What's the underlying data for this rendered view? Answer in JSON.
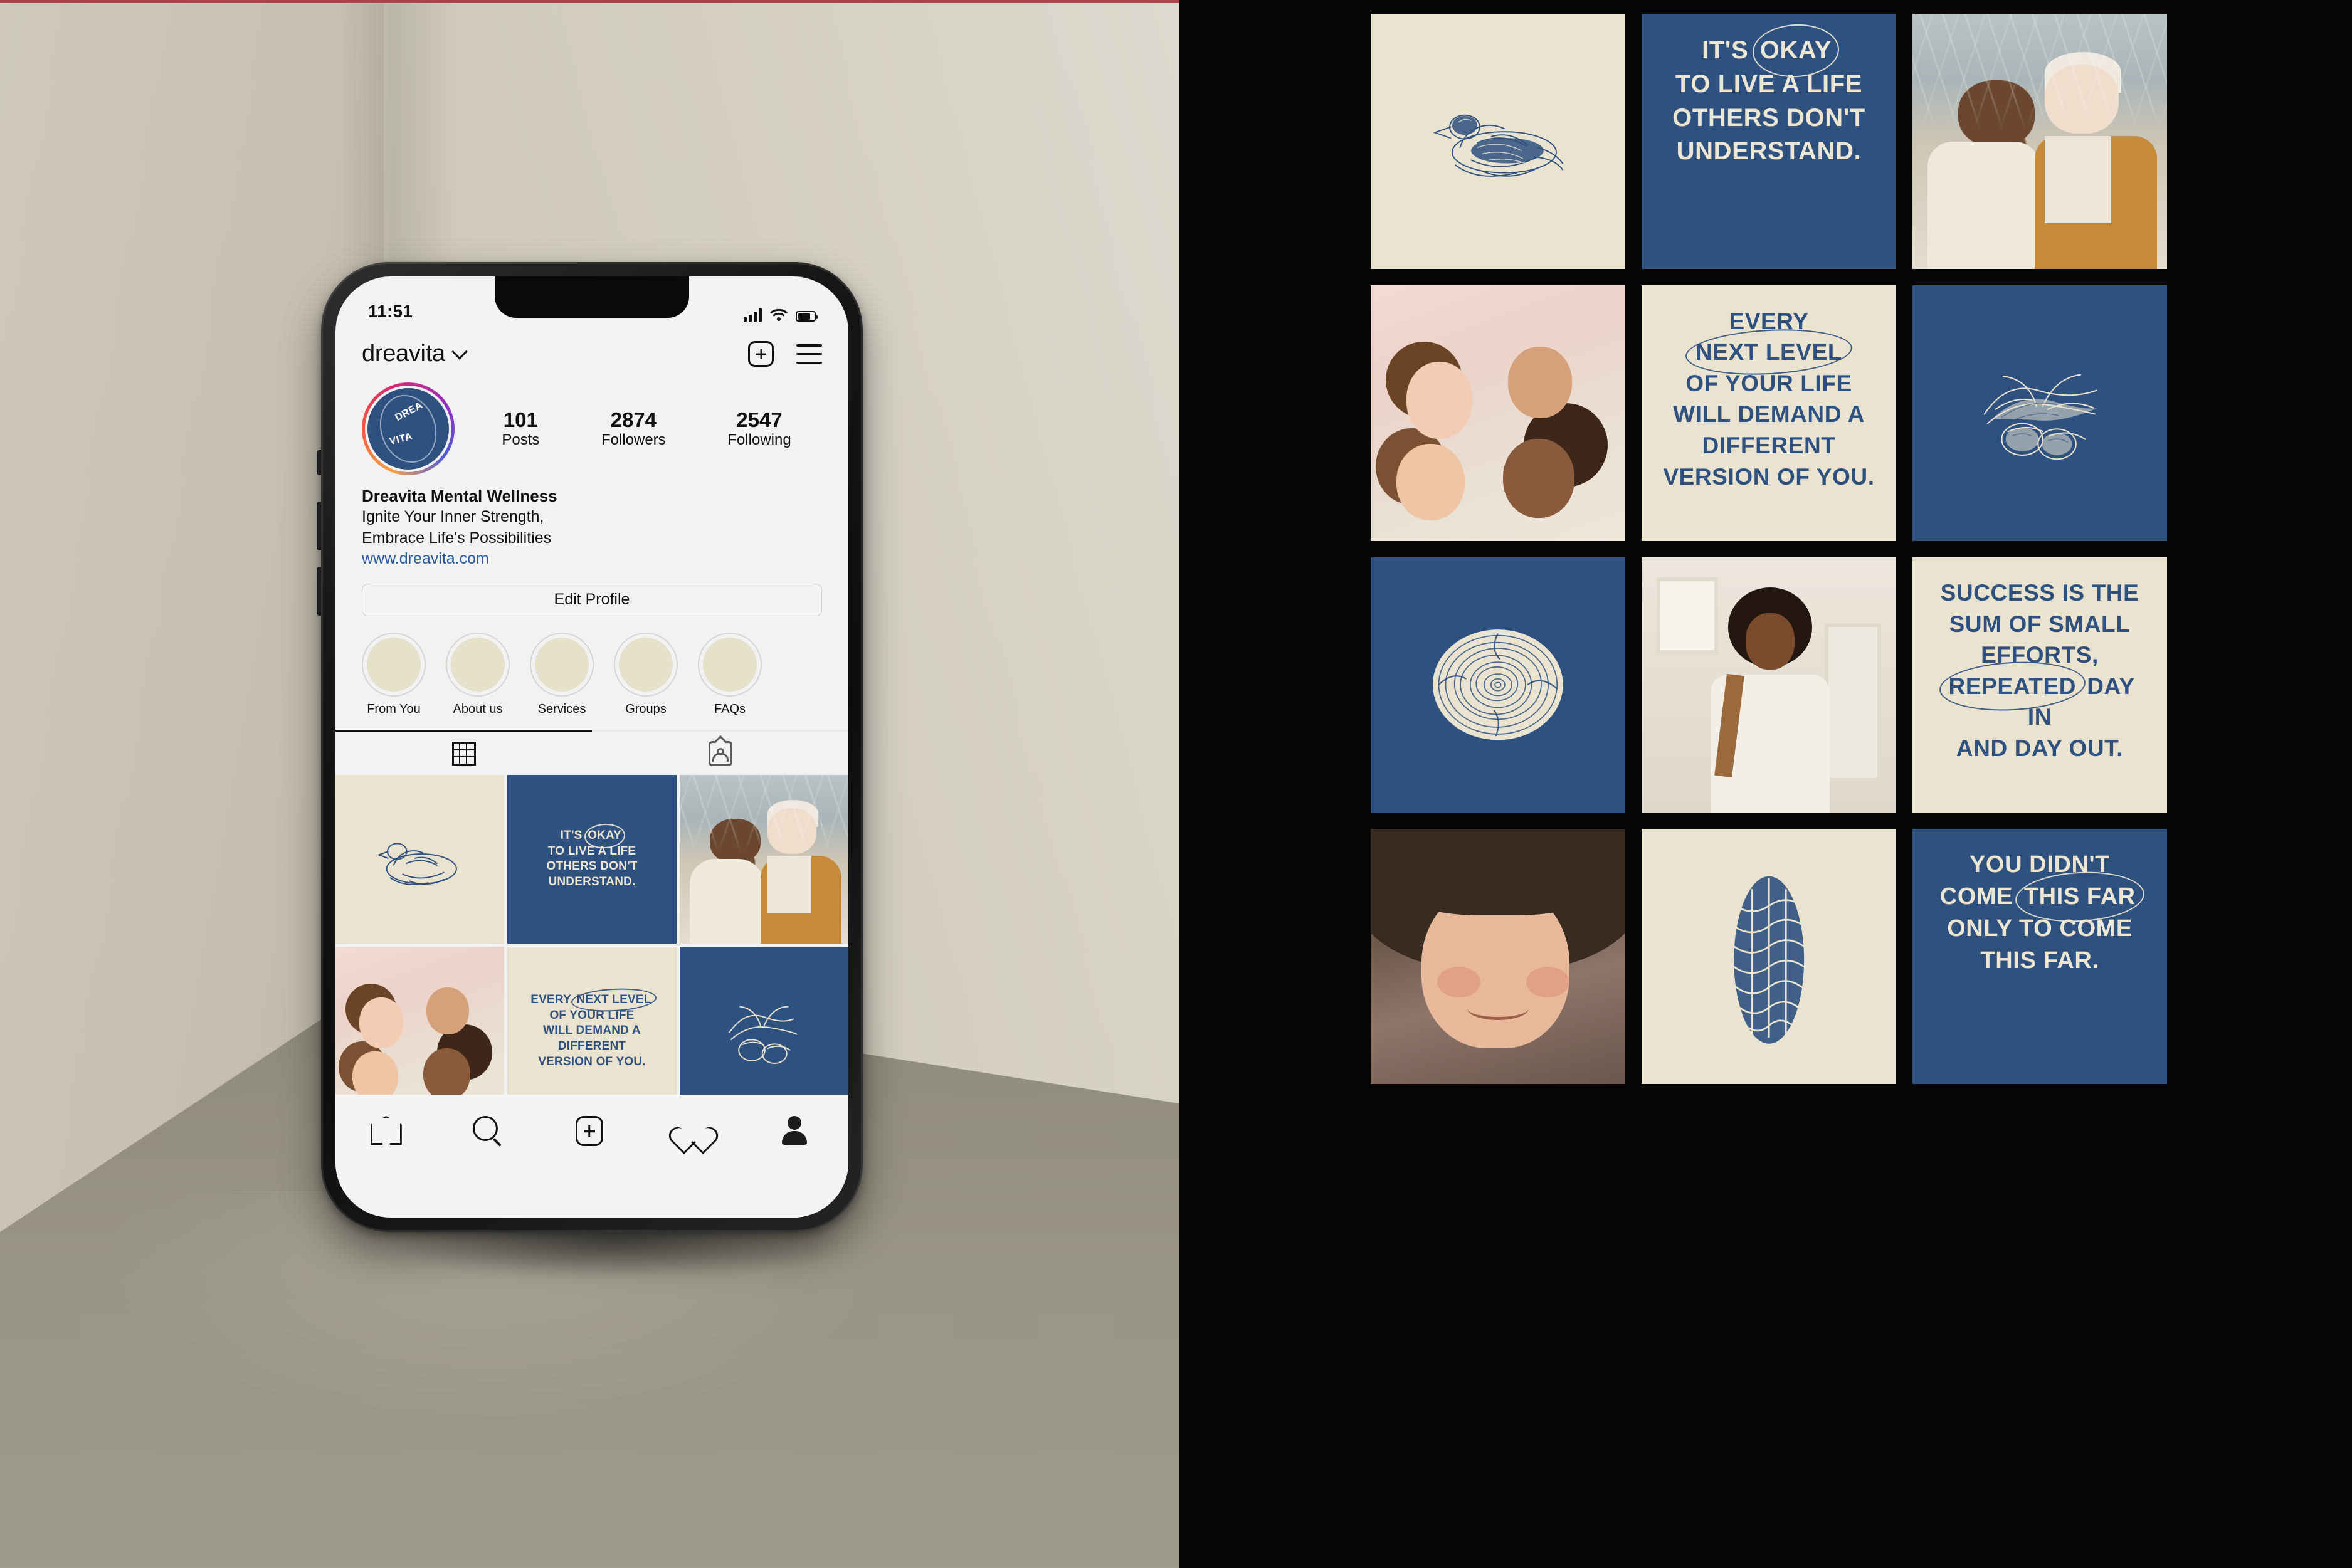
{
  "left_panel": {
    "scene": "phone-mockup-on-desk",
    "phone": {
      "status_bar": {
        "time": "11:51",
        "signal_icon": "signal-bars-icon",
        "wifi_icon": "wifi-icon",
        "battery_icon": "battery-icon"
      },
      "header": {
        "username": "dreavita",
        "chevron_icon": "chevron-down-icon",
        "add_icon": "plus-square-icon",
        "menu_icon": "hamburger-menu-icon"
      },
      "avatar": {
        "logo_line1": "DREA",
        "logo_line2": "VITA",
        "ring_style": "instagram-gradient"
      },
      "stats": [
        {
          "value": "101",
          "label": "Posts"
        },
        {
          "value": "2874",
          "label": "Followers"
        },
        {
          "value": "2547",
          "label": "Following"
        }
      ],
      "bio": {
        "display_name": "Dreavita Mental Wellness",
        "line1": "Ignite Your Inner Strength,",
        "line2": "Embrace Life's Possibilities",
        "link": "www.dreavita.com"
      },
      "edit_profile_label": "Edit Profile",
      "highlights": [
        {
          "label": "From You"
        },
        {
          "label": "About us"
        },
        {
          "label": "Services"
        },
        {
          "label": "Groups"
        },
        {
          "label": "FAQs"
        }
      ],
      "tabs": [
        {
          "icon": "grid-icon",
          "active": true
        },
        {
          "icon": "tagged-person-icon",
          "active": false
        }
      ],
      "bottom_nav": [
        {
          "icon": "home-icon"
        },
        {
          "icon": "search-icon"
        },
        {
          "icon": "plus-square-icon"
        },
        {
          "icon": "heart-icon"
        },
        {
          "icon": "profile-person-icon"
        }
      ]
    }
  },
  "right_panel": {
    "background": "#060606",
    "grid_posts": [
      {
        "kind": "engraving",
        "art": "duck-engraving",
        "bg": "cream"
      },
      {
        "kind": "quote",
        "bg": "blue",
        "lines": [
          "IT'S §OKAY§",
          "TO LIVE A LIFE",
          "OTHERS DON'T",
          "UNDERSTAND."
        ]
      },
      {
        "kind": "photo",
        "art": "couple-in-greenhouse",
        "bg": "photo"
      },
      {
        "kind": "photo",
        "art": "four-friends-lying-down",
        "bg": "photo"
      },
      {
        "kind": "quote",
        "bg": "cream",
        "lines": [
          "EVERY §NEXT LEVEL§",
          "OF YOUR LIFE",
          "WILL DEMAND A",
          "DIFFERENT",
          "VERSION OF YOU."
        ]
      },
      {
        "kind": "engraving",
        "art": "flower-fruit-engraving",
        "bg": "blue"
      },
      {
        "kind": "engraving",
        "art": "tree-rings-engraving",
        "bg": "blue"
      },
      {
        "kind": "photo",
        "art": "smiling-woman-porch",
        "bg": "photo"
      },
      {
        "kind": "quote",
        "bg": "cream",
        "lines": [
          "SUCCESS IS THE",
          "SUM OF SMALL",
          "EFFORTS,",
          "§REPEATED§ DAY IN",
          "AND DAY OUT."
        ]
      },
      {
        "kind": "photo",
        "art": "smiling-girl-portrait",
        "bg": "photo"
      },
      {
        "kind": "engraving",
        "art": "pinecone-engraving",
        "bg": "cream"
      },
      {
        "kind": "quote",
        "bg": "blue",
        "lines": [
          "YOU DIDN'T",
          "COME §THIS FAR§",
          "ONLY TO COME",
          "THIS FAR."
        ]
      }
    ]
  },
  "colors": {
    "brand_blue": "#2F5180",
    "brand_cream": "#E9E3CF",
    "panel_black": "#060606",
    "wall_beige": "#D2CCBF",
    "floor_taupe": "#979284",
    "top_rule_red": "#A8444A",
    "link_blue": "#2A5A9E"
  }
}
